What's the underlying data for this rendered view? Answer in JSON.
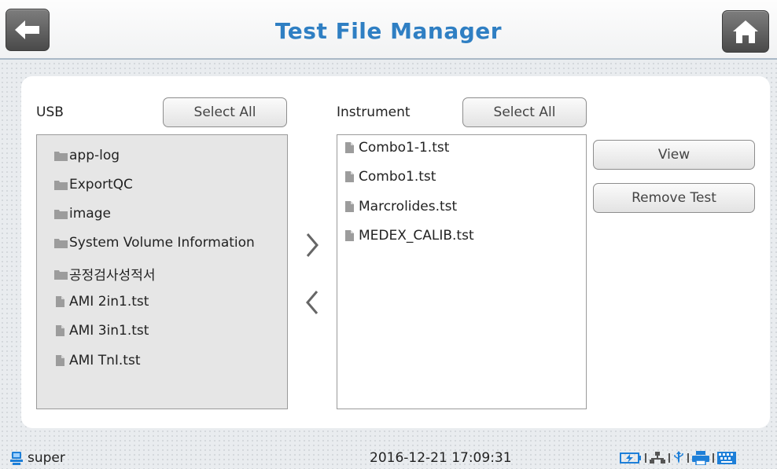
{
  "header": {
    "title": "Test File Manager",
    "back_icon": "back-arrow-icon",
    "home_icon": "home-icon"
  },
  "usb": {
    "label": "USB",
    "select_all": "Select All",
    "items": [
      {
        "name": "app-log",
        "icon": "folder-icon"
      },
      {
        "name": "ExportQC",
        "icon": "folder-icon"
      },
      {
        "name": "image",
        "icon": "folder-icon"
      },
      {
        "name": "System Volume Information",
        "icon": "folder-icon"
      },
      {
        "name": "공정검사성적서",
        "icon": "folder-icon"
      },
      {
        "name": "AMI 2in1.tst",
        "icon": "file-icon"
      },
      {
        "name": "AMI 3in1.tst",
        "icon": "file-icon"
      },
      {
        "name": "AMI TnI.tst",
        "icon": "file-icon"
      }
    ]
  },
  "instrument": {
    "label": "Instrument",
    "select_all": "Select All",
    "items": [
      {
        "name": "Combo1-1.tst",
        "icon": "file-icon"
      },
      {
        "name": "Combo1.tst",
        "icon": "file-icon"
      },
      {
        "name": "Marcrolides.tst",
        "icon": "file-icon"
      },
      {
        "name": "MEDEX_CALIB.tst",
        "icon": "file-icon"
      }
    ]
  },
  "actions": {
    "view": "View",
    "remove_test": "Remove Test",
    "copy_to_instrument_icon": "chevron-right-icon",
    "copy_to_usb_icon": "chevron-left-icon"
  },
  "status": {
    "user": "super",
    "datetime": "2016-12-21 17:09:31",
    "colors": {
      "accent": "#2f7fc3",
      "tray": "#1e7fd8"
    }
  }
}
